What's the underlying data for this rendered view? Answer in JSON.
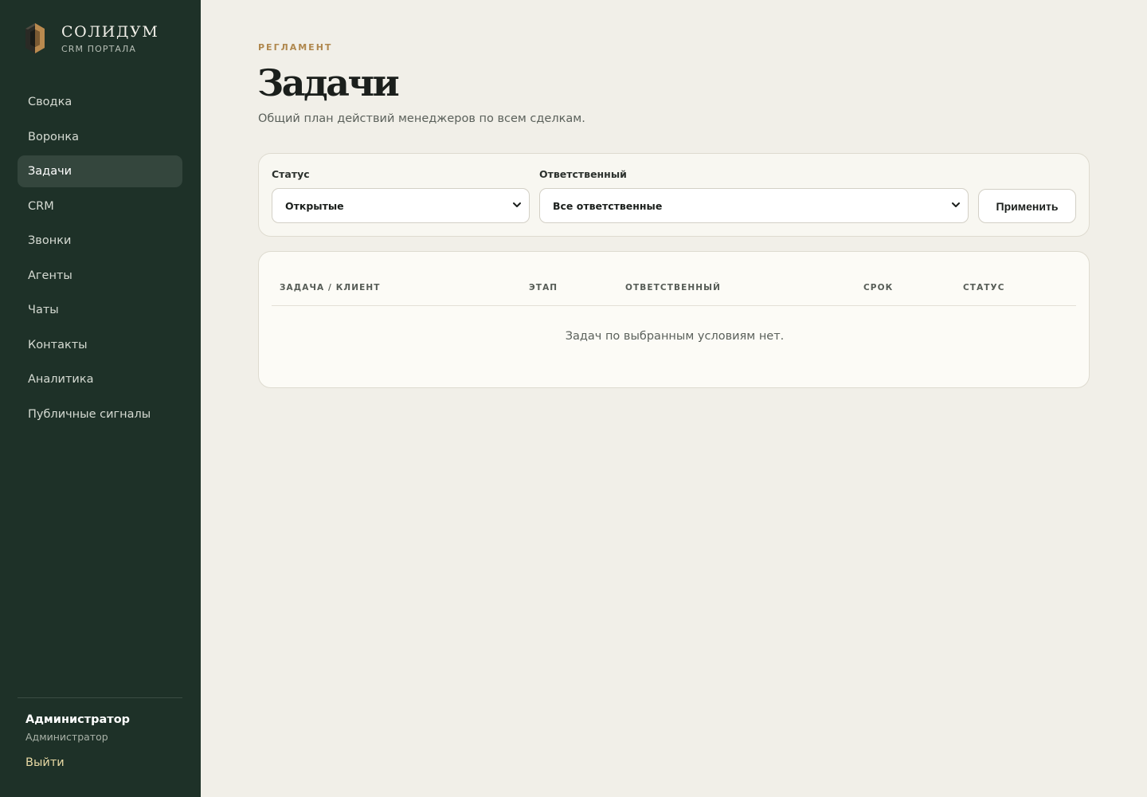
{
  "brand": {
    "title": "СОЛИДУМ",
    "subtitle": "CRM ПОРТАЛА",
    "colors": {
      "sidebar_bg": "#1e3128",
      "accent_gold": "#b0884e",
      "logout_text": "#e8d9a4"
    }
  },
  "sidebar": {
    "items": [
      {
        "label": "Сводка",
        "active": false
      },
      {
        "label": "Воронка",
        "active": false
      },
      {
        "label": "Задачи",
        "active": true
      },
      {
        "label": "CRM",
        "active": false
      },
      {
        "label": "Звонки",
        "active": false
      },
      {
        "label": "Агенты",
        "active": false
      },
      {
        "label": "Чаты",
        "active": false
      },
      {
        "label": "Контакты",
        "active": false
      },
      {
        "label": "Аналитика",
        "active": false
      },
      {
        "label": "Публичные сигналы",
        "active": false
      }
    ],
    "user": {
      "name": "Администратор",
      "role": "Администратор"
    },
    "logout_label": "Выйти"
  },
  "page": {
    "eyebrow": "РЕГЛАМЕНТ",
    "title": "Задачи",
    "description": "Общий план действий менеджеров по всем сделкам."
  },
  "filters": {
    "status": {
      "label": "Статус",
      "value": "Открытые",
      "icon": "chevron-down-icon"
    },
    "assignee": {
      "label": "Ответственный",
      "value": "Все ответственные",
      "icon": "chevron-down-icon"
    },
    "apply_label": "Применить"
  },
  "table": {
    "columns": [
      "ЗАДАЧА / КЛИЕНТ",
      "ЭТАП",
      "ОТВЕТСТВЕННЫЙ",
      "СРОК",
      "СТАТУС"
    ],
    "rows": [],
    "empty_message": "Задач по выбранным условиям нет."
  }
}
